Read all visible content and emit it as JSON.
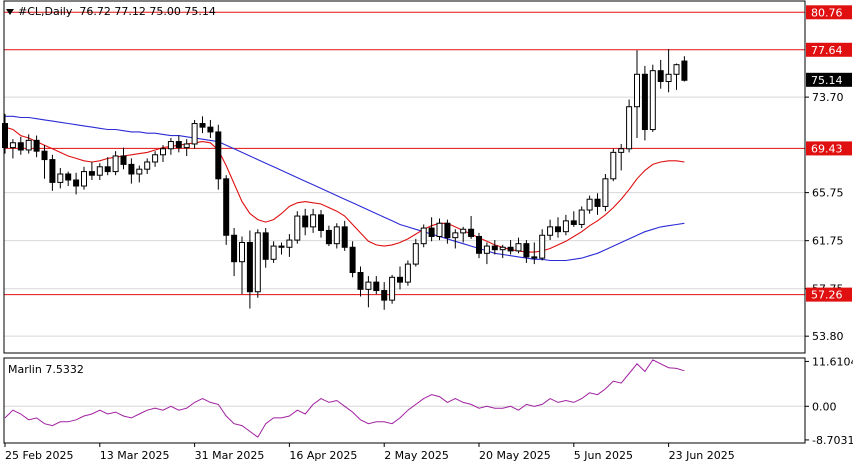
{
  "header": {
    "symbol": "#CL,Daily",
    "ohlc": "76.72 77.12 75.00 75.14"
  },
  "indicator": {
    "name": "Marlin",
    "value": "7.5332"
  },
  "colors": {
    "bull_body": "#ffffff",
    "bear_body": "#000000",
    "ma_blue": "#2b2bd6",
    "ma_red": "#e01010",
    "level": "#e01010",
    "marlin": "#a020a0",
    "grid": "#d8d8d8",
    "bg": "#ffffff"
  },
  "chart_data": [
    {
      "type": "candlestick",
      "y_ticks": [
        "73.70",
        "65.75",
        "61.75",
        "57.75",
        "53.80"
      ],
      "ylim": [
        52.4,
        81.7
      ],
      "x_ticks": [
        "25 Feb 2025",
        "13 Mar 2025",
        "31 Mar 2025",
        "16 Apr 2025",
        "2 May 2025",
        "20 May 2025",
        "5 Jun 2025",
        "23 Jun 2025"
      ],
      "price_labels": [
        {
          "text": "80.76",
          "value": 80.76,
          "style": "level"
        },
        {
          "text": "77.64",
          "value": 77.64,
          "style": "level"
        },
        {
          "text": "75.14",
          "value": 75.14,
          "style": "current"
        },
        {
          "text": "69.43",
          "value": 69.43,
          "style": "level"
        },
        {
          "text": "57.26",
          "value": 57.26,
          "style": "level"
        }
      ],
      "levels": [
        80.76,
        77.64,
        69.43,
        57.26
      ],
      "candles": [
        [
          71.5,
          72.3,
          69.0,
          69.5
        ],
        [
          69.5,
          70.2,
          68.6,
          69.9
        ],
        [
          69.9,
          70.4,
          68.9,
          69.3
        ],
        [
          69.3,
          70.6,
          69.0,
          70.1
        ],
        [
          70.1,
          70.5,
          68.7,
          69.2
        ],
        [
          69.2,
          69.7,
          66.9,
          68.5
        ],
        [
          68.5,
          68.9,
          65.9,
          66.6
        ],
        [
          66.6,
          67.8,
          66.1,
          67.3
        ],
        [
          67.3,
          67.5,
          66.3,
          66.8
        ],
        [
          66.8,
          67.4,
          65.6,
          66.3
        ],
        [
          66.3,
          67.9,
          66.0,
          67.5
        ],
        [
          67.5,
          68.3,
          66.8,
          67.2
        ],
        [
          67.2,
          68.2,
          66.8,
          67.9
        ],
        [
          67.9,
          68.7,
          67.2,
          67.5
        ],
        [
          67.5,
          69.2,
          67.2,
          68.8
        ],
        [
          68.8,
          69.5,
          67.7,
          68.1
        ],
        [
          68.1,
          68.6,
          66.5,
          67.3
        ],
        [
          67.3,
          68.0,
          66.6,
          67.7
        ],
        [
          67.7,
          68.6,
          67.3,
          68.3
        ],
        [
          68.3,
          69.2,
          67.9,
          68.9
        ],
        [
          68.9,
          69.7,
          68.3,
          69.4
        ],
        [
          69.4,
          70.3,
          68.9,
          70.0
        ],
        [
          70.0,
          70.5,
          69.1,
          69.5
        ],
        [
          69.5,
          70.2,
          68.8,
          69.8
        ],
        [
          69.8,
          71.8,
          69.4,
          71.5
        ],
        [
          71.5,
          72.1,
          70.7,
          71.2
        ],
        [
          71.2,
          71.8,
          70.3,
          70.8
        ],
        [
          70.8,
          71.4,
          66.0,
          66.9
        ],
        [
          66.9,
          67.2,
          61.4,
          62.2
        ],
        [
          62.2,
          62.8,
          58.8,
          60.0
        ],
        [
          60.0,
          62.1,
          57.3,
          61.6
        ],
        [
          61.6,
          62.6,
          56.1,
          57.5
        ],
        [
          57.5,
          62.7,
          57.0,
          62.4
        ],
        [
          62.4,
          62.8,
          59.5,
          60.2
        ],
        [
          60.2,
          61.7,
          59.9,
          61.3
        ],
        [
          61.3,
          61.6,
          60.6,
          61.2
        ],
        [
          61.2,
          62.3,
          60.4,
          61.8
        ],
        [
          61.8,
          64.2,
          61.5,
          63.8
        ],
        [
          63.8,
          64.4,
          62.2,
          62.9
        ],
        [
          62.9,
          64.4,
          62.4,
          63.9
        ],
        [
          63.9,
          64.3,
          62.0,
          62.6
        ],
        [
          62.6,
          63.0,
          61.3,
          61.5
        ],
        [
          61.5,
          63.2,
          61.1,
          62.9
        ],
        [
          62.9,
          63.4,
          60.9,
          61.2
        ],
        [
          61.2,
          61.7,
          58.7,
          59.1
        ],
        [
          59.1,
          59.6,
          57.1,
          57.7
        ],
        [
          57.7,
          58.8,
          56.2,
          58.3
        ],
        [
          58.3,
          58.8,
          57.3,
          57.6
        ],
        [
          57.6,
          58.3,
          56.0,
          56.8
        ],
        [
          56.8,
          58.9,
          56.5,
          58.7
        ],
        [
          58.7,
          59.6,
          57.7,
          58.3
        ],
        [
          58.3,
          60.1,
          58.0,
          59.8
        ],
        [
          59.8,
          61.9,
          59.6,
          61.5
        ],
        [
          61.5,
          63.1,
          61.2,
          62.8
        ],
        [
          62.8,
          63.7,
          61.7,
          62.1
        ],
        [
          62.1,
          63.6,
          61.8,
          63.2
        ],
        [
          63.2,
          63.5,
          61.5,
          62.0
        ],
        [
          62.0,
          62.7,
          61.1,
          62.4
        ],
        [
          62.4,
          62.9,
          61.6,
          62.7
        ],
        [
          62.7,
          63.8,
          61.9,
          62.1
        ],
        [
          62.1,
          62.4,
          60.3,
          60.7
        ],
        [
          60.7,
          61.6,
          59.8,
          61.3
        ],
        [
          61.3,
          61.8,
          60.6,
          61.0
        ],
        [
          61.0,
          61.4,
          60.3,
          61.2
        ],
        [
          61.2,
          61.8,
          60.6,
          60.9
        ],
        [
          60.9,
          62.0,
          60.7,
          61.5
        ],
        [
          61.5,
          61.8,
          59.9,
          60.4
        ],
        [
          60.4,
          61.6,
          59.8,
          60.3
        ],
        [
          60.3,
          62.7,
          60.1,
          62.2
        ],
        [
          62.2,
          63.5,
          61.8,
          62.9
        ],
        [
          62.9,
          63.7,
          62.0,
          62.5
        ],
        [
          62.5,
          63.9,
          62.2,
          63.4
        ],
        [
          63.4,
          64.2,
          62.9,
          63.1
        ],
        [
          63.1,
          64.6,
          62.8,
          64.3
        ],
        [
          64.3,
          65.5,
          64.0,
          65.2
        ],
        [
          65.2,
          65.7,
          63.9,
          64.6
        ],
        [
          64.6,
          67.3,
          64.2,
          66.9
        ],
        [
          66.9,
          69.4,
          66.7,
          69.1
        ],
        [
          69.1,
          69.8,
          67.6,
          69.4
        ],
        [
          69.4,
          73.5,
          69.1,
          72.9
        ],
        [
          72.9,
          77.6,
          70.3,
          75.6
        ],
        [
          75.6,
          76.3,
          70.1,
          71.0
        ],
        [
          71.0,
          76.4,
          70.8,
          75.9
        ],
        [
          75.9,
          76.8,
          74.4,
          75.0
        ],
        [
          75.0,
          77.7,
          74.1,
          75.6
        ],
        [
          75.6,
          76.5,
          74.3,
          76.4
        ],
        [
          76.7,
          77.1,
          75.0,
          75.1
        ]
      ],
      "ma_red": [
        71.2,
        71.0,
        70.5,
        70.3,
        70.0,
        69.7,
        69.4,
        69.1,
        68.8,
        68.6,
        68.4,
        68.3,
        68.4,
        68.6,
        68.7,
        68.8,
        68.9,
        69.0,
        69.1,
        69.3,
        69.5,
        69.6,
        69.7,
        69.8,
        69.9,
        70.0,
        69.9,
        69.3,
        68.0,
        66.5,
        65.0,
        64.0,
        63.5,
        63.3,
        63.5,
        64.0,
        64.6,
        64.9,
        65.0,
        64.9,
        64.8,
        64.5,
        64.2,
        63.8,
        63.1,
        62.4,
        61.7,
        61.4,
        61.3,
        61.4,
        61.6,
        61.9,
        62.3,
        62.7,
        63.0,
        63.2,
        63.2,
        62.9,
        62.6,
        62.3,
        62.0,
        61.7,
        61.4,
        61.2,
        61.0,
        60.9,
        60.8,
        60.8,
        60.9,
        61.1,
        61.4,
        61.7,
        62.1,
        62.5,
        63.0,
        63.4,
        63.9,
        64.5,
        65.2,
        66.0,
        66.9,
        67.6,
        68.1,
        68.3,
        68.4,
        68.4,
        68.3
      ],
      "ma_blue": [
        72.1,
        72.1,
        72.0,
        72.0,
        71.9,
        71.8,
        71.7,
        71.6,
        71.5,
        71.4,
        71.3,
        71.2,
        71.1,
        71.0,
        71.0,
        70.9,
        70.8,
        70.8,
        70.7,
        70.7,
        70.6,
        70.5,
        70.5,
        70.4,
        70.3,
        70.2,
        70.1,
        70.0,
        69.7,
        69.4,
        69.1,
        68.8,
        68.5,
        68.2,
        67.9,
        67.6,
        67.3,
        67.0,
        66.7,
        66.4,
        66.1,
        65.8,
        65.5,
        65.2,
        64.9,
        64.6,
        64.3,
        64.0,
        63.7,
        63.4,
        63.1,
        62.9,
        62.7,
        62.5,
        62.3,
        62.1,
        61.9,
        61.7,
        61.5,
        61.3,
        61.1,
        60.9,
        60.7,
        60.6,
        60.5,
        60.4,
        60.3,
        60.2,
        60.2,
        60.1,
        60.1,
        60.1,
        60.2,
        60.3,
        60.5,
        60.7,
        61.0,
        61.3,
        61.6,
        61.9,
        62.2,
        62.5,
        62.7,
        62.9,
        63.0,
        63.1,
        63.2
      ]
    },
    {
      "type": "line",
      "name": "Marlin",
      "y_ticks": [
        "11.6104",
        "0.00",
        "-8.7031"
      ],
      "ylim": [
        -9.5,
        12.5
      ],
      "values": [
        -3.0,
        -1.0,
        -2.0,
        -3.5,
        -3.0,
        -4.5,
        -5.0,
        -4.0,
        -4.0,
        -3.5,
        -2.5,
        -2.0,
        -1.0,
        -2.0,
        -1.5,
        -2.5,
        -3.0,
        -2.0,
        -1.0,
        -0.5,
        -1.0,
        0.0,
        -1.0,
        -0.5,
        1.0,
        2.0,
        1.0,
        0.5,
        -2.5,
        -4.5,
        -5.0,
        -6.5,
        -8.0,
        -4.5,
        -3.0,
        -3.0,
        -2.5,
        -1.0,
        -2.0,
        0.5,
        2.0,
        1.0,
        1.5,
        0.0,
        -1.5,
        -3.5,
        -4.5,
        -4.0,
        -4.0,
        -4.5,
        -3.0,
        -1.0,
        0.5,
        2.0,
        3.0,
        2.5,
        1.0,
        2.0,
        1.0,
        0.5,
        -0.5,
        0.0,
        -0.5,
        -0.5,
        0.0,
        -1.0,
        0.5,
        0.0,
        0.5,
        2.0,
        1.0,
        1.5,
        1.0,
        2.0,
        3.5,
        3.0,
        4.5,
        6.5,
        6.0,
        8.5,
        11.0,
        9.0,
        12.0,
        11.0,
        10.0,
        9.8,
        9.2
      ]
    }
  ]
}
